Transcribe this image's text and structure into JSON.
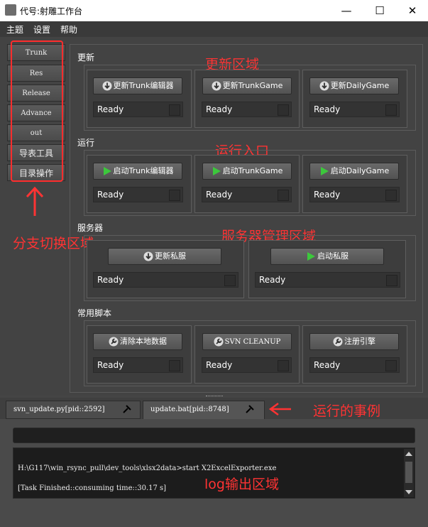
{
  "window": {
    "title": "代号:射雕工作台",
    "controls": {
      "minimize": "—",
      "maximize": "☐",
      "close": "✕"
    }
  },
  "menubar": {
    "items": [
      "主题",
      "设置",
      "帮助"
    ]
  },
  "branches": [
    "Trunk",
    "Res",
    "Release",
    "Advance",
    "out",
    "导表工具",
    "目录操作"
  ],
  "sections": {
    "update": {
      "title": "更新",
      "buttons": [
        "更新Trunk编辑器",
        "更新TrunkGame",
        "更新DailyGame"
      ],
      "statuses": [
        "Ready",
        "Ready",
        "Ready"
      ]
    },
    "run": {
      "title": "运行",
      "buttons": [
        "启动Trunk编辑器",
        "启动TrunkGame",
        "启动DailyGame"
      ],
      "statuses": [
        "Ready",
        "Ready",
        "Ready"
      ]
    },
    "server": {
      "title": "服务器",
      "buttons": [
        "更新私服",
        "启动私服"
      ],
      "statuses": [
        "Ready",
        "Ready"
      ]
    },
    "scripts": {
      "title": "常用脚本",
      "buttons": [
        "清除本地数据",
        "SVN CLEANUP",
        "注册引擎"
      ],
      "statuses": [
        "Ready",
        "Ready",
        "Ready"
      ]
    }
  },
  "annotations": {
    "update_region": "更新区域",
    "run_entry": "运行入口",
    "server_region": "服务器管理区域",
    "branch_switch": "分支切换区域",
    "instances": "运行的事例",
    "log_region": "log输出区域"
  },
  "tabs": [
    {
      "label": "svn_update.py[pid::2592]",
      "active": false
    },
    {
      "label": "update.bat[pid::8748]",
      "active": true
    }
  ],
  "log": {
    "lines": [
      "H:\\G117\\win_rsync_pull\\dev_tools\\xlsx2data>start X2ExcelExporter.exe",
      "[Task Finished::consuming time::30.17 s]"
    ]
  },
  "icons": {
    "update": "download-icon",
    "run": "play-icon",
    "script": "wrench-icon",
    "tab_close": "pin-close-icon"
  },
  "colors": {
    "annotation_red": "#ff3333",
    "play_green": "#3cc83c",
    "background": "#454545"
  }
}
